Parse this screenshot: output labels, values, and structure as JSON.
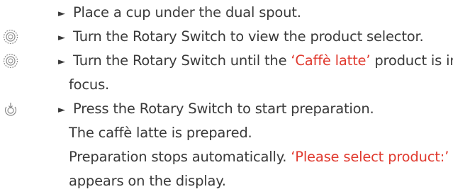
{
  "steps": [
    {
      "icon": "none",
      "arrow": "►",
      "text": "Place a cup under the dual spout."
    },
    {
      "icon": "rotary-dial-icon",
      "arrow": "►",
      "text": "Turn the Rotary Switch to view the product selector."
    },
    {
      "icon": "rotary-dial-icon",
      "arrow": "►",
      "text_before": "Turn the Rotary Switch until the ",
      "highlight": "‘Caffè latte’",
      "text_after": " product is in",
      "continuation": "focus."
    },
    {
      "icon": "press-button-icon",
      "arrow": "►",
      "text": "Press the Rotary Switch to start preparation.",
      "result_1": "The caffè latte is prepared.",
      "result_2_before": "Preparation stops automatically. ",
      "result_2_highlight": "‘Please select product:’",
      "result_3": "appears on the display."
    }
  ],
  "colors": {
    "text": "#3a3a3a",
    "highlight": "#e03a2f",
    "icon": "#8a8a8a"
  }
}
